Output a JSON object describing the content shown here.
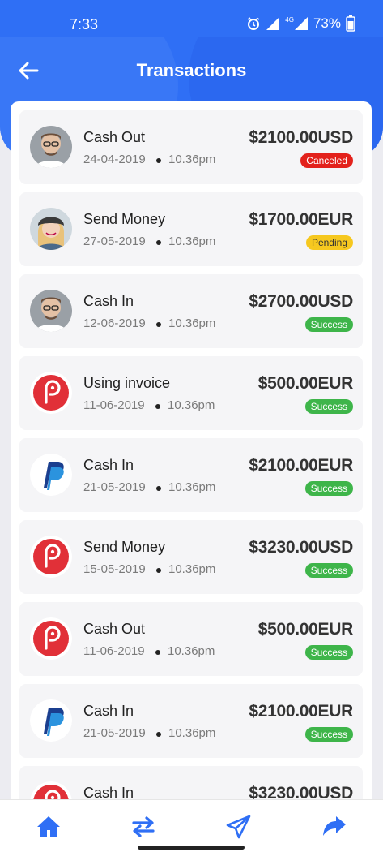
{
  "status_bar": {
    "time": "7:33",
    "network": "4G",
    "battery": "73%"
  },
  "header": {
    "title": "Transactions",
    "back_icon": "arrow-left-icon",
    "accent_color": "#2f6ff5"
  },
  "transactions": [
    {
      "title": "Cash Out",
      "date": "24-04-2019",
      "time": "10.36pm",
      "amount": "$2100.00USD",
      "status": "Canceled",
      "avatar": "man-photo"
    },
    {
      "title": "Send Money",
      "date": "27-05-2019",
      "time": "10.36pm",
      "amount": "$1700.00EUR",
      "status": "Pending",
      "avatar": "woman-photo"
    },
    {
      "title": "Cash In",
      "date": "12-06-2019",
      "time": "10.36pm",
      "amount": "$2700.00USD",
      "status": "Success",
      "avatar": "man-photo"
    },
    {
      "title": "Using invoice",
      "date": "11-06-2019",
      "time": "10.36pm",
      "amount": "$500.00EUR",
      "status": "Success",
      "avatar": "payoneer-logo"
    },
    {
      "title": "Cash In",
      "date": "21-05-2019",
      "time": "10.36pm",
      "amount": "$2100.00EUR",
      "status": "Success",
      "avatar": "paypal-logo"
    },
    {
      "title": "Send Money",
      "date": "15-05-2019",
      "time": "10.36pm",
      "amount": "$3230.00USD",
      "status": "Success",
      "avatar": "payoneer-logo"
    },
    {
      "title": "Cash Out",
      "date": "11-06-2019",
      "time": "10.36pm",
      "amount": "$500.00EUR",
      "status": "Success",
      "avatar": "payoneer-logo"
    },
    {
      "title": "Cash In",
      "date": "21-05-2019",
      "time": "10.36pm",
      "amount": "$2100.00EUR",
      "status": "Success",
      "avatar": "paypal-logo"
    },
    {
      "title": "Cash In",
      "date": "",
      "time": "",
      "amount": "$3230.00USD",
      "status": "",
      "avatar": "payoneer-logo"
    }
  ],
  "bottom_nav": [
    {
      "icon": "home-icon"
    },
    {
      "icon": "transfer-icon"
    },
    {
      "icon": "send-icon"
    },
    {
      "icon": "share-icon"
    }
  ],
  "colors": {
    "canceled": "#e3221c",
    "pending": "#f6c81f",
    "success": "#3eb54a"
  }
}
